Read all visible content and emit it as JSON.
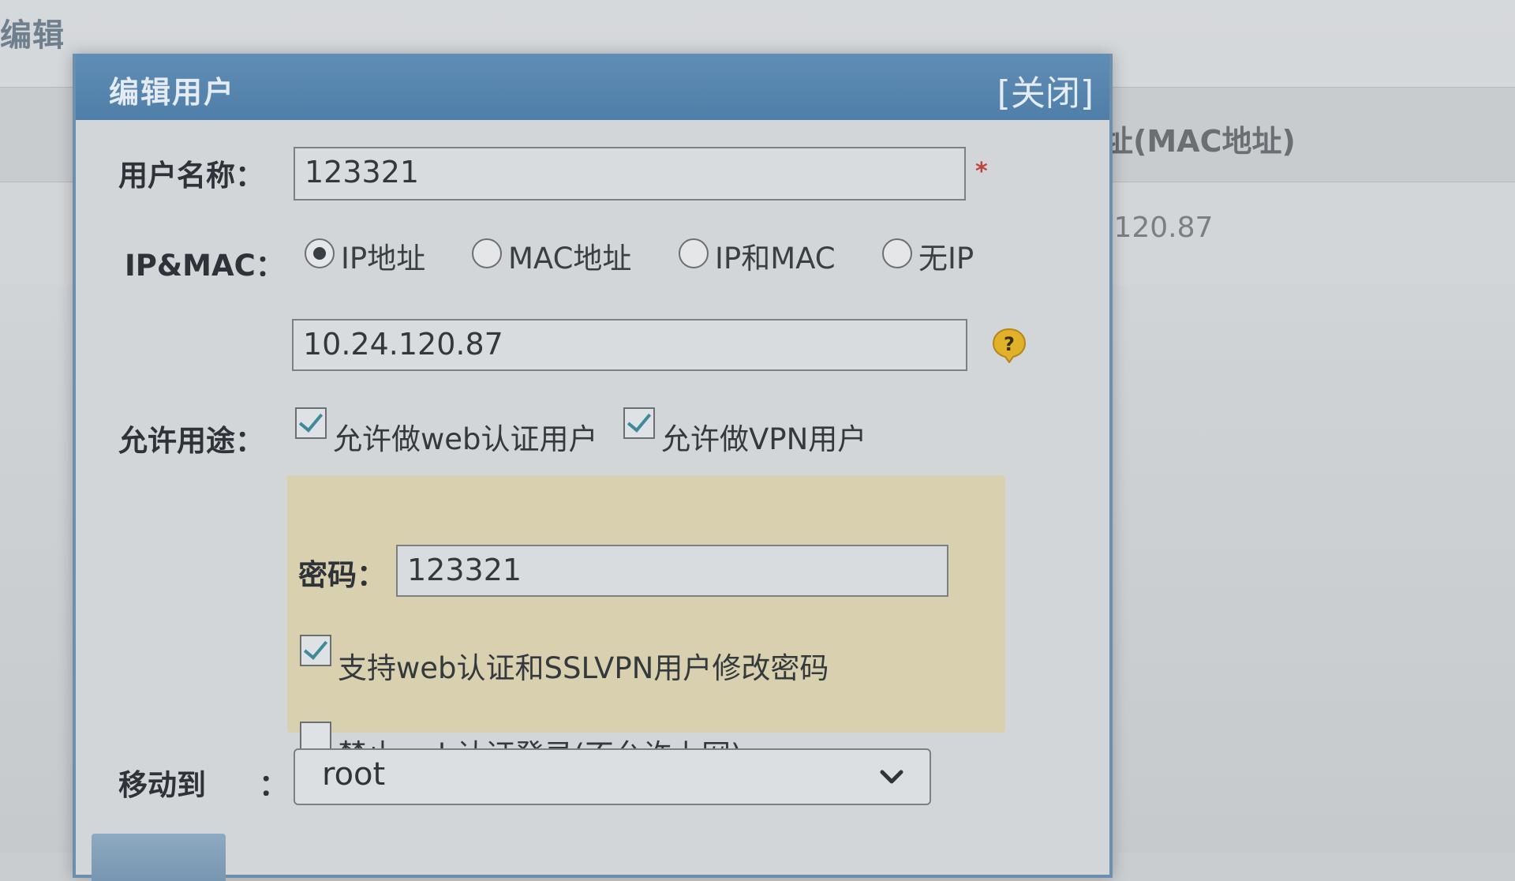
{
  "background": {
    "page_title": "编辑",
    "column_header": "址(MAC地址)",
    "cell_value": ".120.87"
  },
  "dialog": {
    "title": "编辑用户",
    "close_label": "[关闭]",
    "username": {
      "label": "用户名称：",
      "value": "123321",
      "required_mark": "*"
    },
    "ipmac": {
      "label": "IP&MAC：",
      "options": [
        {
          "label": "IP地址",
          "checked": true
        },
        {
          "label": "MAC地址",
          "checked": false
        },
        {
          "label": "IP和MAC",
          "checked": false
        },
        {
          "label": "无IP",
          "checked": false
        }
      ],
      "ip_value": "10.24.120.87",
      "help_icon": "question-bubble-icon"
    },
    "usage": {
      "label": "允许用途：",
      "web_auth": {
        "label": "允许做web认证用户",
        "checked": true
      },
      "vpn": {
        "label": "允许做VPN用户",
        "checked": true
      }
    },
    "password_panel": {
      "label": "密码：",
      "value": "123321",
      "allow_change": {
        "label": "支持web认证和SSLVPN用户修改密码",
        "checked": true
      },
      "forbid_login": {
        "label": "禁止web认证登录(不允许上网)",
        "checked": false
      }
    },
    "move_to": {
      "label": "移动到",
      "colon": "：",
      "selected": "root"
    }
  },
  "colors": {
    "header_blue": "#5a88b1",
    "panel_yellow": "#d8d0ae",
    "required_red": "#c0443d",
    "help_yellow": "#e2b12a"
  }
}
